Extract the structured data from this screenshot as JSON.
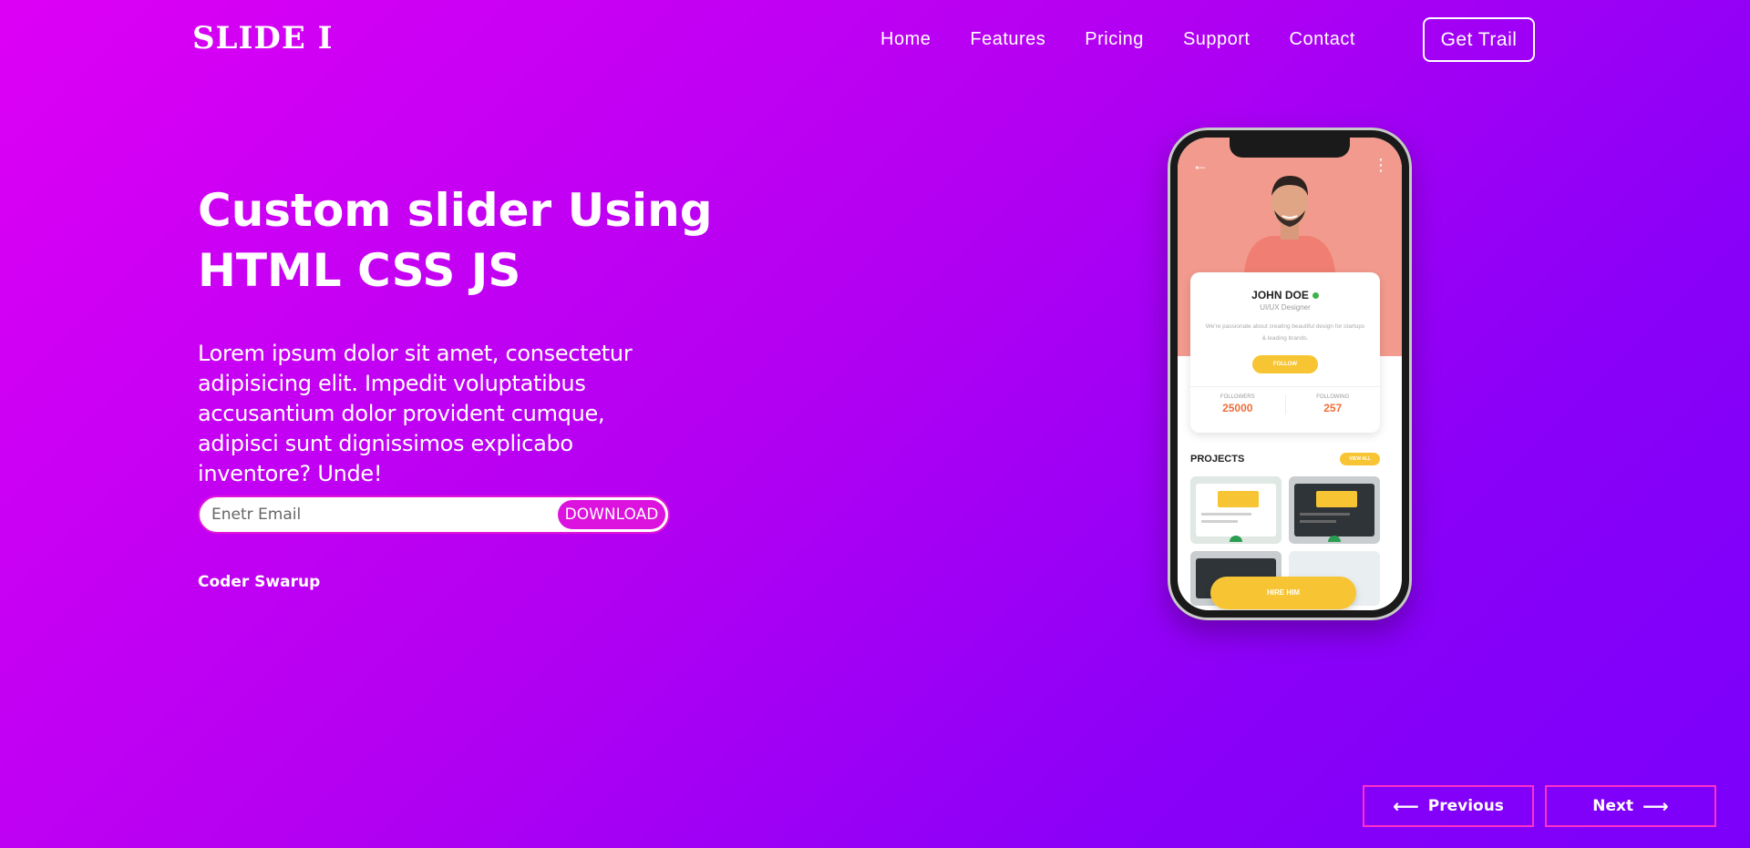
{
  "header": {
    "logo": "SLIDE I",
    "nav": [
      "Home",
      "Features",
      "Pricing",
      "Support",
      "Contact"
    ],
    "cta_label": "Get Trail"
  },
  "hero": {
    "title_line1": "Custom slider Using",
    "title_line2": "HTML CSS JS",
    "description": "Lorem ipsum dolor sit amet, consectetur adipisicing elit. Impedit voluptatibus accusantium dolor provident cumque, adipisci sunt dignissimos explicabo inventore? Unde!",
    "email_placeholder": "Enetr Email",
    "download_label": "DOWNLOAD",
    "author": "Coder Swarup"
  },
  "phone": {
    "profile_name": "JOHN DOE",
    "profile_role": "UI/UX Designer",
    "profile_bio": "We're passionate about creating beautiful design for startups & leading brands.",
    "follow_label": "FOLLOW",
    "followers_label": "FOLLOWERS",
    "followers_value": "25000",
    "following_label": "FOLLOWING",
    "following_value": "257",
    "projects_title": "PROJECTS",
    "view_all_label": "VIEW ALL",
    "hire_label": "HIRE HIM"
  },
  "slider": {
    "prev_label": "Previous",
    "next_label": "Next"
  },
  "colors": {
    "gradient_start": "#dd00f5",
    "gradient_end": "#7b00fa",
    "download_button": "#dc12de",
    "slider_border": "#ff30c8",
    "accent_yellow": "#f7c533",
    "profile_bg": "#f29a8d"
  },
  "icons": {
    "prev_arrow": "arrow-left-icon",
    "next_arrow": "arrow-right-icon",
    "back": "back-arrow-icon",
    "menu": "more-vertical-icon"
  }
}
